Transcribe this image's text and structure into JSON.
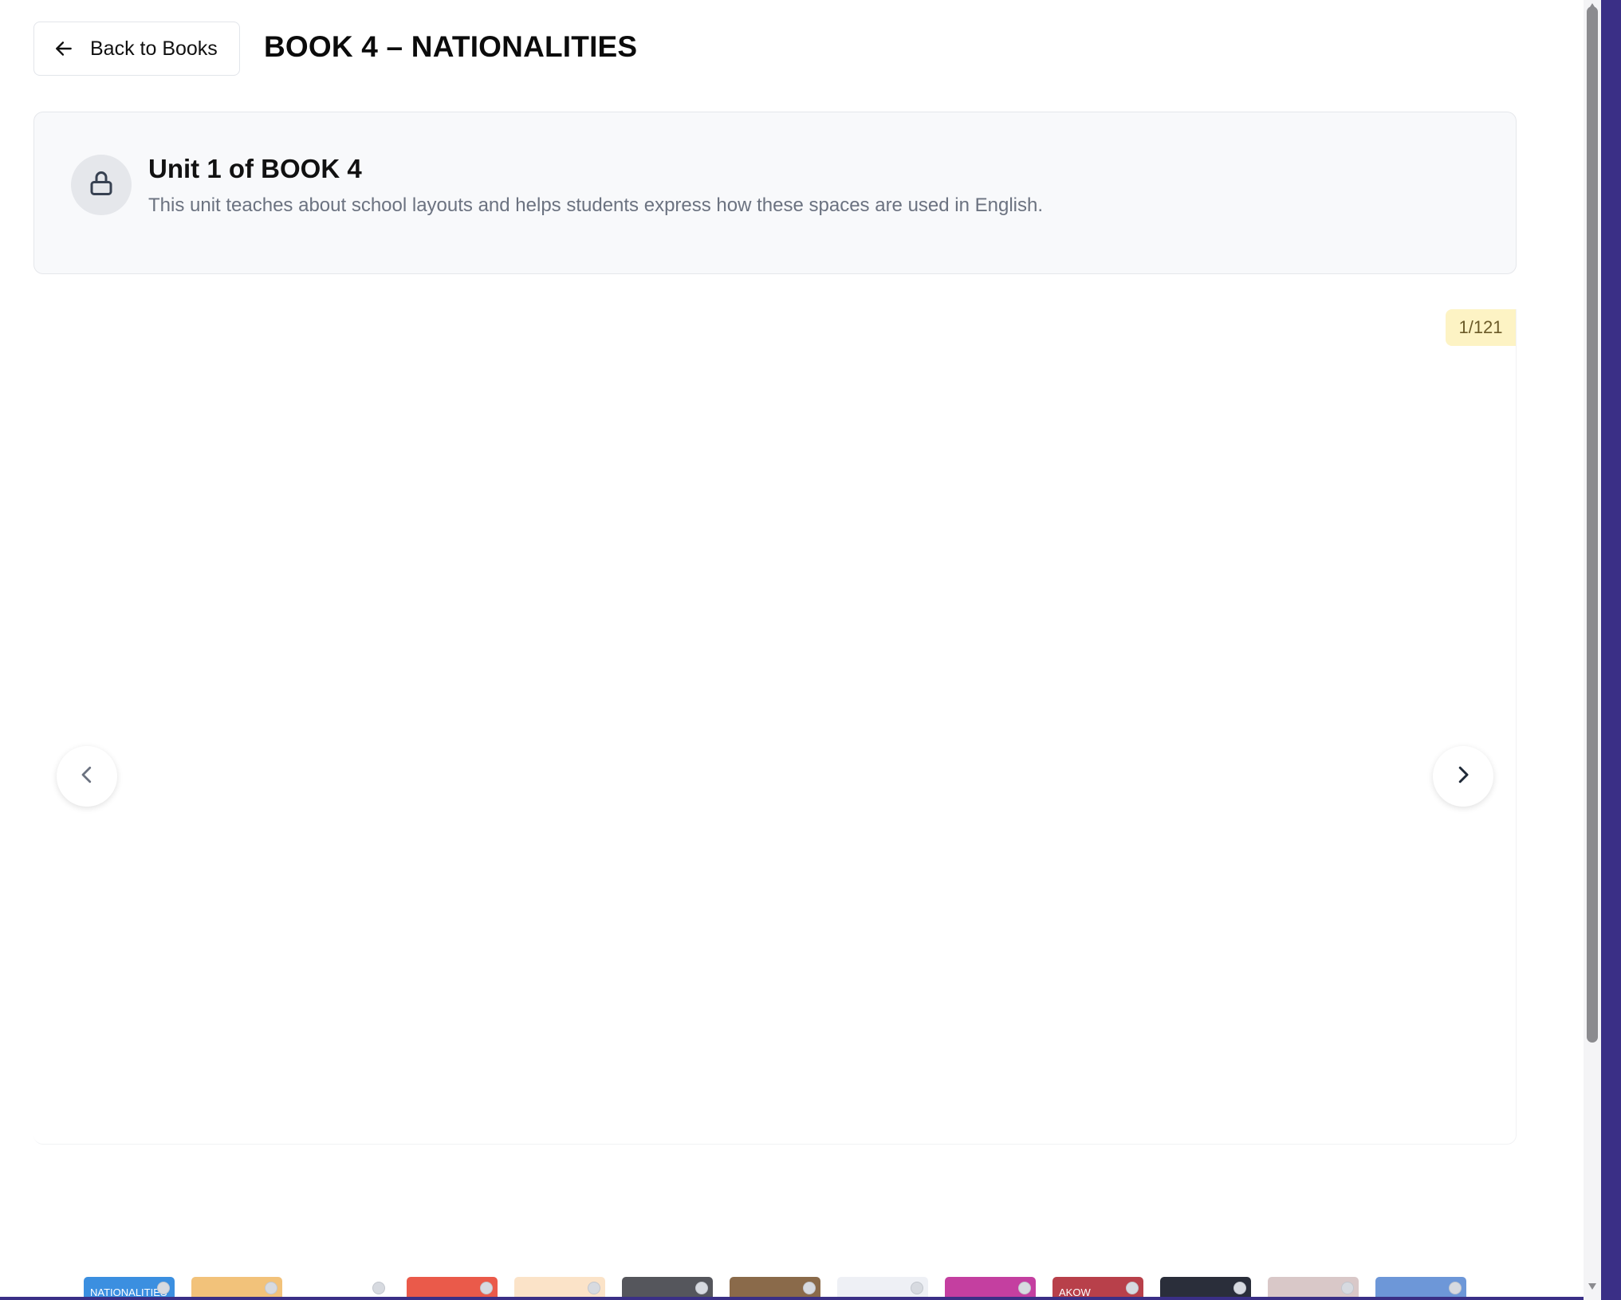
{
  "header": {
    "back_label": "Back to Books",
    "title": "BOOK 4 – NATIONALITIES"
  },
  "unit": {
    "title": "Unit 1 of BOOK 4",
    "description": "This unit teaches about school layouts and helps students express how these spaces are used in English."
  },
  "viewer": {
    "page_counter": "1/121",
    "prev_icon": "chevron-left-icon",
    "next_icon": "chevron-right-icon"
  },
  "thumbnails": [
    {
      "label": "NATIONALITIES",
      "color": "#3b8fe0"
    },
    {
      "label": "",
      "color": "#f2c27a"
    },
    {
      "label": "",
      "color": "#ffffff"
    },
    {
      "label": "",
      "color": "#ea5a4a"
    },
    {
      "label": "",
      "color": "#fbe3c8"
    },
    {
      "label": "",
      "color": "#55565c"
    },
    {
      "label": "",
      "color": "#8a6a4a"
    },
    {
      "label": "",
      "color": "#eef0f5"
    },
    {
      "label": "",
      "color": "#c43fa0"
    },
    {
      "label": "AKOW",
      "color": "#b8404a"
    },
    {
      "label": "",
      "color": "#2a2e3a"
    },
    {
      "label": "",
      "color": "#d9c8c8"
    },
    {
      "label": "",
      "color": "#6d97d8"
    }
  ],
  "colors": {
    "card_background": "#f8f9fb",
    "counter_background": "#fdf3c4",
    "frame_accent": "#3a2f86"
  }
}
